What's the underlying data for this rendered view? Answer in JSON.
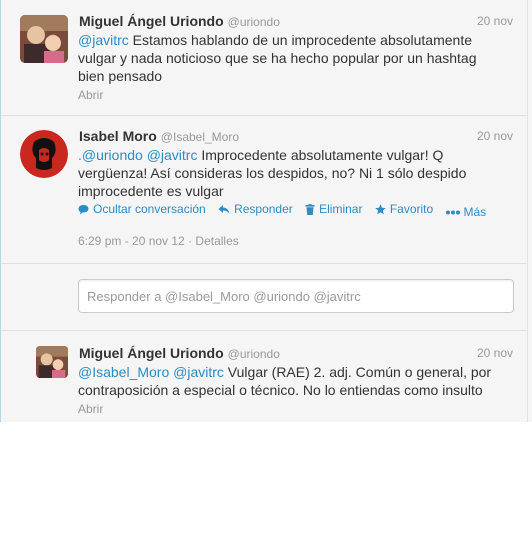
{
  "tweets": [
    {
      "name": "Miguel Ángel Uriondo",
      "handle": "@uriondo",
      "date": "20 nov",
      "mentions": [
        "@javitrc"
      ],
      "body": " Estamos hablando de un improcedente absolutamente vulgar y nada noticioso que se ha hecho popular por un hashtag bien pensado",
      "open_label": "Abrir"
    },
    {
      "name": "Isabel Moro",
      "handle": "@Isabel_Moro",
      "date": "20 nov",
      "mentions_text": ".@uriondo @javitrc",
      "body": " Improcedente absolutamente vulgar! Q vergüenza! Así consideras los despidos, no? Ni 1 sólo despido improcedente es vulgar",
      "actions": {
        "hide_conversation": "Ocultar conversación",
        "reply": "Responder",
        "delete": "Eliminar",
        "favorite": "Favorito",
        "more": "Más"
      },
      "timestamp": "6:29 pm - 20 nov 12",
      "separator": " · ",
      "details": "Detalles"
    },
    {
      "name": "Miguel Ángel Uriondo",
      "handle": "@uriondo",
      "date": "20 nov",
      "mentions_text": "@Isabel_Moro @javitrc",
      "body": " Vulgar (RAE) 2. adj. Común o general, por contraposición a especial o técnico. No lo entiendas como insulto",
      "open_label": "Abrir"
    }
  ],
  "reply_box": {
    "placeholder": "Responder a @Isabel_Moro @uriondo @javitrc"
  },
  "colors": {
    "link": "#2c8cc4",
    "muted": "#999999",
    "text": "#333333",
    "background": "#f5f5f5"
  },
  "icons": [
    "speech-bubble-icon",
    "reply-arrow-icon",
    "trash-icon",
    "star-icon",
    "more-dots-icon"
  ]
}
